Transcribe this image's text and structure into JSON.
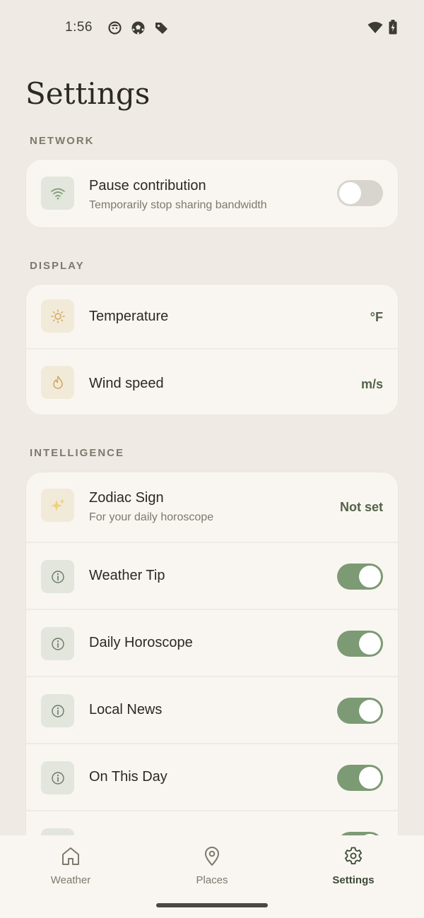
{
  "status_bar": {
    "time": "1:56",
    "left_icons": [
      "face-icon",
      "soccer-ball-icon",
      "tag-icon"
    ],
    "right_icons": [
      "wifi-icon",
      "battery-charging-icon"
    ]
  },
  "page_title": "Settings",
  "sections": {
    "network": {
      "label": "NETWORK",
      "rows": [
        {
          "icon": "wifi-icon",
          "title": "Pause contribution",
          "subtitle": "Temporarily stop sharing bandwidth",
          "toggle": "off"
        }
      ]
    },
    "display": {
      "label": "DISPLAY",
      "rows": [
        {
          "icon": "sun-icon",
          "title": "Temperature",
          "value": "°F"
        },
        {
          "icon": "flame-icon",
          "title": "Wind speed",
          "value": "m/s"
        }
      ]
    },
    "intelligence": {
      "label": "INTELLIGENCE",
      "rows": [
        {
          "icon": "sparkles-icon",
          "title": "Zodiac Sign",
          "subtitle": "For your daily horoscope",
          "value": "Not set"
        },
        {
          "icon": "info-icon",
          "title": "Weather Tip",
          "toggle": "on"
        },
        {
          "icon": "info-icon",
          "title": "Daily Horoscope",
          "toggle": "on"
        },
        {
          "icon": "info-icon",
          "title": "Local News",
          "toggle": "on"
        },
        {
          "icon": "info-icon",
          "title": "On This Day",
          "toggle": "on"
        }
      ]
    }
  },
  "bottom_nav": {
    "items": [
      {
        "label": "Weather",
        "icon": "home-icon",
        "active": false
      },
      {
        "label": "Places",
        "icon": "location-pin-icon",
        "active": false
      },
      {
        "label": "Settings",
        "icon": "gear-icon",
        "active": true
      }
    ]
  },
  "colors": {
    "background": "#efebe4",
    "card": "#f9f6f1",
    "accent_green": "#7c9a74",
    "value_text": "#53624a",
    "muted_text": "#7c7a6c"
  }
}
